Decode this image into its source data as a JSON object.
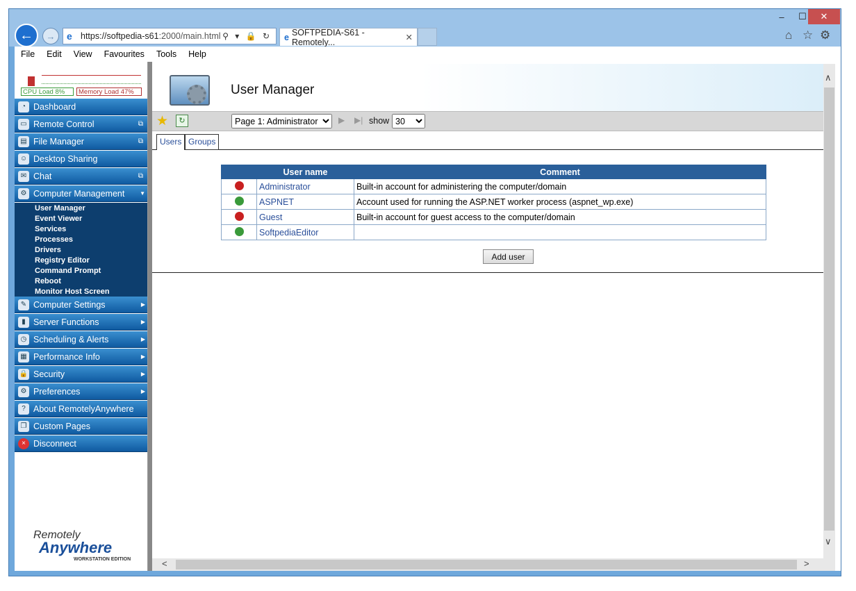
{
  "window": {
    "min_glyph": "–",
    "max_glyph": "☐",
    "close_glyph": "✕"
  },
  "browser": {
    "back_glyph": "←",
    "fwd_glyph": "→",
    "url_host": "https://softpedia-s61",
    "url_path": ":2000/main.html",
    "url_tools": "⚲ ▾ 🔒 ↻",
    "tab_title": "SOFTPEDIA-S61 - Remotely...",
    "tab_close": "✕",
    "home": "⌂",
    "favorites": "☆",
    "settings": "⚙"
  },
  "menu": {
    "items": [
      "File",
      "Edit",
      "View",
      "Favourites",
      "Tools",
      "Help"
    ]
  },
  "gauges": {
    "cpu": "CPU Load 8%",
    "mem": "Memory Load 47%"
  },
  "sidebar": {
    "items": [
      {
        "label": "Dashboard",
        "icon": "dashboard-icon"
      },
      {
        "label": "Remote Control",
        "icon": "remote-control-icon"
      },
      {
        "label": "File Manager",
        "icon": "file-manager-icon"
      },
      {
        "label": "Desktop Sharing",
        "icon": "desktop-sharing-icon"
      },
      {
        "label": "Chat",
        "icon": "chat-icon"
      },
      {
        "label": "Computer Management",
        "icon": "computer-management-icon"
      }
    ],
    "sub_items": [
      "User Manager",
      "Event Viewer",
      "Services",
      "Processes",
      "Drivers",
      "Registry Editor",
      "Command Prompt",
      "Reboot",
      "Monitor Host Screen"
    ],
    "lower_items": [
      {
        "label": "Computer Settings"
      },
      {
        "label": "Server Functions"
      },
      {
        "label": "Scheduling & Alerts"
      },
      {
        "label": "Performance Info"
      },
      {
        "label": "Security"
      },
      {
        "label": "Preferences"
      },
      {
        "label": "About RemotelyAnywhere"
      },
      {
        "label": "Custom Pages"
      },
      {
        "label": "Disconnect"
      }
    ],
    "logo": {
      "line1": "Remotely",
      "line2": "Anywhere",
      "line3": "WORKSTATION EDITION"
    }
  },
  "page": {
    "title": "User Manager",
    "page_select": "Page 1: Administrator",
    "show_label": "show",
    "show_count": "30",
    "tabs": [
      "Users",
      "Groups"
    ],
    "columns": [
      "",
      "User name",
      "Comment"
    ],
    "rows": [
      {
        "name": "Administrator",
        "comment": "Built-in account for administering the computer/domain",
        "status": "disabled"
      },
      {
        "name": "ASPNET",
        "comment": "Account used for running the ASP.NET worker process (aspnet_wp.exe)",
        "status": "enabled"
      },
      {
        "name": "Guest",
        "comment": "Built-in account for guest access to the computer/domain",
        "status": "disabled"
      },
      {
        "name": "SoftpediaEditor",
        "comment": "",
        "status": "enabled"
      }
    ],
    "add_user": "Add user"
  }
}
